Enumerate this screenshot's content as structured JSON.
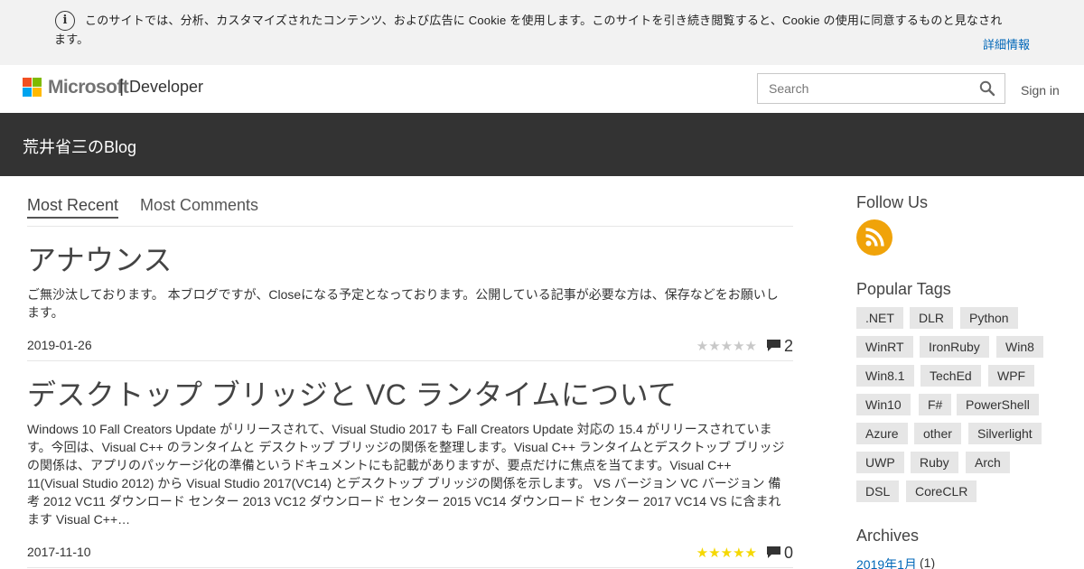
{
  "cookie": {
    "text": "このサイトでは、分析、カスタマイズされたコンテンツ、および広告に Cookie を使用します。このサイトを引き続き閲覧すると、Cookie の使用に同意するものと見なされます。",
    "more_label": "詳細情報"
  },
  "header": {
    "brand": "Microsoft",
    "separator": "|",
    "section": "Developer",
    "search_placeholder": "Search",
    "signin_label": "Sign in"
  },
  "blog": {
    "title": "荒井省三のBlog"
  },
  "tabs": [
    {
      "label": "Most Recent",
      "active": true
    },
    {
      "label": "Most Comments",
      "active": false
    }
  ],
  "posts": [
    {
      "title": "アナウンス",
      "excerpt": "ご無沙汰しております。 本ブログですが、Closeになる予定となっております。公開している記事が必要な方は、保存などをお願いします。",
      "date": "2019-01-26",
      "rating": 0,
      "comments": "2"
    },
    {
      "title": "デスクトップ ブリッジと VC ランタイムについて",
      "excerpt": "Windows 10 Fall Creators Update がリリースされて、Visual Studio 2017 も Fall Creators Update 対応の 15.4 がリリースされています。今回は、Visual C++ のランタイムと デスクトップ ブリッジの関係を整理します。Visual C++ ランタイムとデスクトップ ブリッジの関係は、アプリのパッケージ化の準備というドキュメントにも記載がありますが、要点だけに焦点を当てます。Visual C++ 11(Visual Studio 2012) から Visual Studio 2017(VC14) とデスクトップ ブリッジの関係を示します。 VS バージョン VC バージョン 備考 2012 VC11 ダウンロード センター 2013 VC12 ダウンロード センター 2015 VC14 ダウンロード センター 2017 VC14 VS に含まれます Visual C++…",
      "date": "2017-11-10",
      "rating": 5,
      "comments": "0"
    }
  ],
  "sidebar": {
    "follow_heading": "Follow Us",
    "tags_heading": "Popular Tags",
    "tags": [
      ".NET",
      "DLR",
      "Python",
      "WinRT",
      "IronRuby",
      "Win8",
      "Win8.1",
      "TechEd",
      "WPF",
      "Win10",
      "F#",
      "PowerShell",
      "Azure",
      "other",
      "Silverlight",
      "UWP",
      "Ruby",
      "Arch",
      "DSL",
      "CoreCLR"
    ],
    "archives_heading": "Archives",
    "archives": [
      {
        "label": "2019年1月",
        "count": "(1)"
      }
    ]
  },
  "colors": {
    "accent_link": "#0067b8",
    "title_bar": "#333333",
    "rss": "#f0a30a",
    "star_filled": "#f5d800",
    "star_empty": "#c8c8c8"
  },
  "icons": {
    "info": "info-circle-icon",
    "search": "search-icon",
    "rss": "rss-icon",
    "comment": "comment-bubble-icon",
    "star": "star-icon"
  }
}
